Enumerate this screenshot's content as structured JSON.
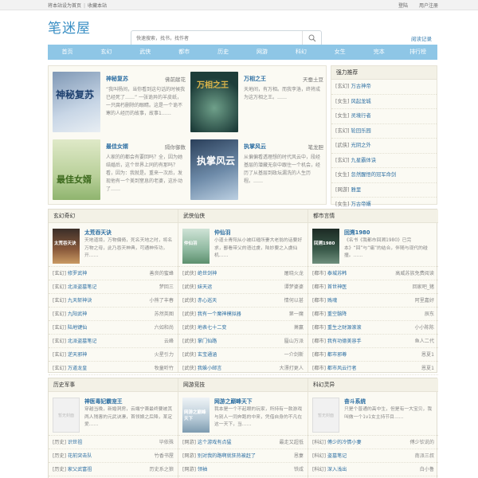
{
  "topbar": {
    "left1": "将本站设为首页",
    "sep": "|",
    "left2": "收藏本站",
    "login": "登陆",
    "register": "用户注册"
  },
  "header": {
    "logo": "笔迷屋",
    "search_placeholder": "快速搜索，找书，找作者",
    "history": "阅读记录"
  },
  "nav": [
    "首页",
    "玄幻",
    "武侠",
    "都市",
    "历史",
    "网游",
    "科幻",
    "女生",
    "完本",
    "排行榜"
  ],
  "featured": [
    {
      "title": "神秘复苏",
      "author": "佛前献花",
      "desc": "“我叫杨间，当你看到这句话的时候我已经死了……” 一张诡异的羊皮纸，一只腐朽删除的眼睛。这是一个诡不寒的人经历的故事，故事1……",
      "cover_text": "神秘复苏"
    },
    {
      "title": "万相之王",
      "author": "天蚕土豆",
      "desc": "天地间，有万相。而我李洛，终将成为这万相之王。……",
      "cover_text": "万相之王"
    },
    {
      "title": "最佳女婿",
      "author": "隔你御数",
      "desc": "人家的的都会有要回吗？全，因为她结婚后，这个世界上同的有那吗？看，因为：我就是。重来一次后，发现他有一个美到窒息的老婆，这扑动了……",
      "cover_text": "最佳女婿"
    },
    {
      "title": "执掌风云",
      "author": "笔龙胆",
      "desc": "从偏偏看透理想的时代风云中，段经基层的潜藏无奈中跟住一个机会，经历了从基层到政坛漏洗的人生历程。……",
      "cover_text": "执掌风云"
    }
  ],
  "side": {
    "title": "强力推荐",
    "items": [
      {
        "cat": "[玄幻]",
        "name": "万古神帝"
      },
      {
        "cat": "[女生]",
        "name": "风起龙城"
      },
      {
        "cat": "[女生]",
        "name": "灵境行者"
      },
      {
        "cat": "[玄幻]",
        "name": "轮回乐园"
      },
      {
        "cat": "[武侠]",
        "name": "光阴之外"
      },
      {
        "cat": "[玄幻]",
        "name": "九星霸体诀"
      },
      {
        "cat": "[女生]",
        "name": "忽然醒悟的冠军命剑"
      },
      {
        "cat": "[网游]",
        "name": "雅里"
      },
      {
        "cat": "[女生]",
        "name": "万古帝婿"
      }
    ]
  },
  "sections1": [
    {
      "head": "玄幻奇幻",
      "top": {
        "title": "太荒吞天诀",
        "desc": "天地道境，万物偏倚，死名天地之时，将名万物之母，此乃吞天神典，可通神传功，开……",
        "cover_text": "太荒吞天诀"
      },
      "rows": [
        {
          "cat": "[玄幻]",
          "name": "修罗武神",
          "author": "善良的蜜蜂"
        },
        {
          "cat": "[玄幻]",
          "name": "北派盗墓笔记",
          "author": "梦回三"
        },
        {
          "cat": "[玄幻]",
          "name": "九天斩神诀",
          "author": "小熊了丰春"
        },
        {
          "cat": "[玄幻]",
          "name": "九阳武神",
          "author": "苏然英图"
        },
        {
          "cat": "[玄幻]",
          "name": "陆地键仙",
          "author": "六如和尚"
        },
        {
          "cat": "[玄幻]",
          "name": "北派盗墓笔记",
          "author": "云峰"
        },
        {
          "cat": "[玄幻]",
          "name": "逆天邪神",
          "author": "火星引力"
        },
        {
          "cat": "[玄幻]",
          "name": "万道龙皇",
          "author": "牧童听竹"
        }
      ]
    },
    {
      "head": "武侠仙侠",
      "top": {
        "title": "仲仙羽",
        "desc": "小道士青阳从小被红缝所妻大老翁的话要好求，鄙看带父的语过虞，陆妙要之入虞仙机……",
        "cover_text": "仲仙羽"
      },
      "rows": [
        {
          "cat": "[武侠]",
          "name": "绝世剑神",
          "author": "屠晓火龙"
        },
        {
          "cat": "[武侠]",
          "name": "妹天运",
          "author": "谭梦婆婆"
        },
        {
          "cat": "[武侠]",
          "name": "赤心巡天",
          "author": "情何以甚"
        },
        {
          "cat": "[武侠]",
          "name": "我有一个魔神模拟器",
          "author": "第一魔"
        },
        {
          "cat": "[武侠]",
          "name": "地表七十二变",
          "author": "萧赢"
        },
        {
          "cat": "[武侠]",
          "name": "掌门仙路",
          "author": "蜃山万派"
        },
        {
          "cat": "[武侠]",
          "name": "玄宝通涵",
          "author": "一介剑斯"
        },
        {
          "cat": "[武侠]",
          "name": "我躲小邮言",
          "author": "大漂打更人"
        }
      ]
    },
    {
      "head": "都市言情",
      "top": {
        "title": "回溯1980",
        "desc": "《名书《我都市回溯1980》已完本》“回”与“痛”的结合，伴随与现代的碰撞。……",
        "cover_text": "回溯1980"
      },
      "rows": [
        {
          "cat": "[都市]",
          "name": "泰城苏韩",
          "author": "高威苏族免费阅读"
        },
        {
          "cat": "[都市]",
          "name": "首世神医",
          "author": "回家吧_猪"
        },
        {
          "cat": "[都市]",
          "name": "贱魂",
          "author": "阿里嘉好"
        },
        {
          "cat": "[都市]",
          "name": "重空骸降",
          "author": "辰东"
        },
        {
          "cat": "[都市]",
          "name": "重生之财源滚滚",
          "author": "小小陈陈"
        },
        {
          "cat": "[都市]",
          "name": "我有功德美容手",
          "author": "鱼人二代"
        },
        {
          "cat": "[都市]",
          "name": "都市邪尊",
          "author": "恩夏1"
        },
        {
          "cat": "[都市]",
          "name": "都市风云行者",
          "author": "恩夏1"
        }
      ]
    }
  ],
  "sections2": [
    {
      "head": "历史军事",
      "top": {
        "title": "神医毒妃霸宠王",
        "desc": "穿越当晚，新婚洞房，云端宁萧最终要被其两人残害的元武诀凄，首领娘之后降，某定爱……",
        "cover_text": "暂无封面"
      },
      "rows": [
        {
          "cat": "[历史]",
          "name": "识世祖",
          "author": "毕依殊"
        },
        {
          "cat": "[历史]",
          "name": "花前突击队",
          "author": "竹香书屋"
        },
        {
          "cat": "[历史]",
          "name": "家父武富祖",
          "author": "历史系之狼"
        }
      ]
    },
    {
      "head": "网游竞技",
      "top": {
        "title": "网游之巅峰天下",
        "desc": "我本是一个不起眼的玩家，所持有一款游戏与别人一同奔跑的中来，凭借自身的不凡在这一天下，当……",
        "cover_text": "网游之巅峰天下"
      },
      "rows": [
        {
          "cat": "[网游]",
          "name": "这个游戏有点猛",
          "author": "最走又超低"
        },
        {
          "cat": "[网游]",
          "name": "别对我的路啊就狂热被赶了",
          "author": "恩妻"
        },
        {
          "cat": "[网游]",
          "name": "领袖",
          "author": "铁咸"
        }
      ]
    },
    {
      "head": "科幻灵异",
      "top": {
        "title": "奋斗系统",
        "desc": "只是个普通的高中生，但是有一大宝贝，我叫做一个1v1女主持节目……",
        "cover_text": "暂无封面"
      },
      "rows": [
        {
          "cat": "[科幻]",
          "name": "傅少的冷情小妻",
          "author": "傅少钦说的"
        },
        {
          "cat": "[科幻]",
          "name": "盗墓笔记",
          "author": "南派三叔"
        },
        {
          "cat": "[科幻]",
          "name": "深入浅出",
          "author": "白小鲁"
        }
      ]
    }
  ]
}
